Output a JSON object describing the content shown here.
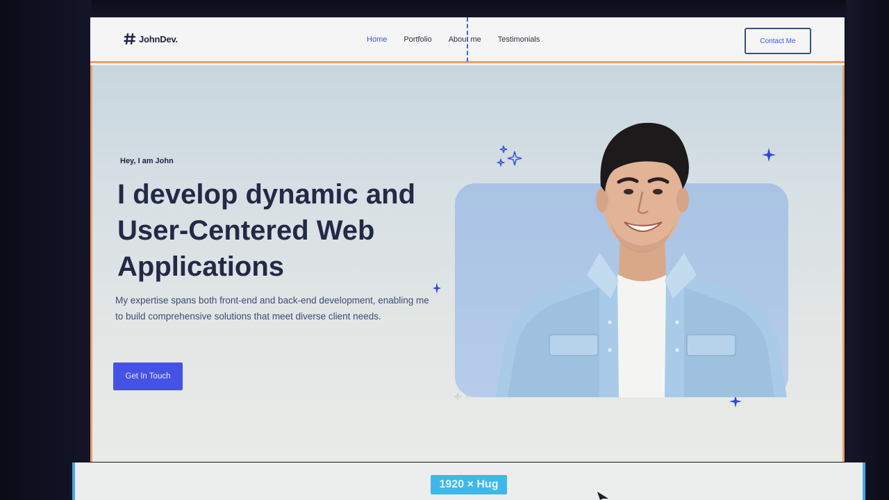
{
  "nav": {
    "logo_text": "JohnDev.",
    "links": [
      "Home",
      "Portfolio",
      "About me",
      "Testimonials"
    ],
    "active_link": "Home",
    "contact_label": "Contact Me"
  },
  "hero": {
    "greeting": "Hey, I am John",
    "headline": "I develop dynamic and User-Centered Web Applications",
    "description": "My expertise spans both front-end and back-end development, enabling me to build comprehensive solutions that meet diverse client needs.",
    "cta_label": "Get In Touch"
  },
  "editor": {
    "size_badge": "1920 × Hug"
  },
  "colors": {
    "accent": "#4552e6",
    "heading": "#232a46",
    "selection_guide": "#46a9e0",
    "frame_border": "#e8a06a"
  },
  "icons": [
    "logo-hash-icon",
    "sparkle-icon",
    "cursor-icon"
  ]
}
